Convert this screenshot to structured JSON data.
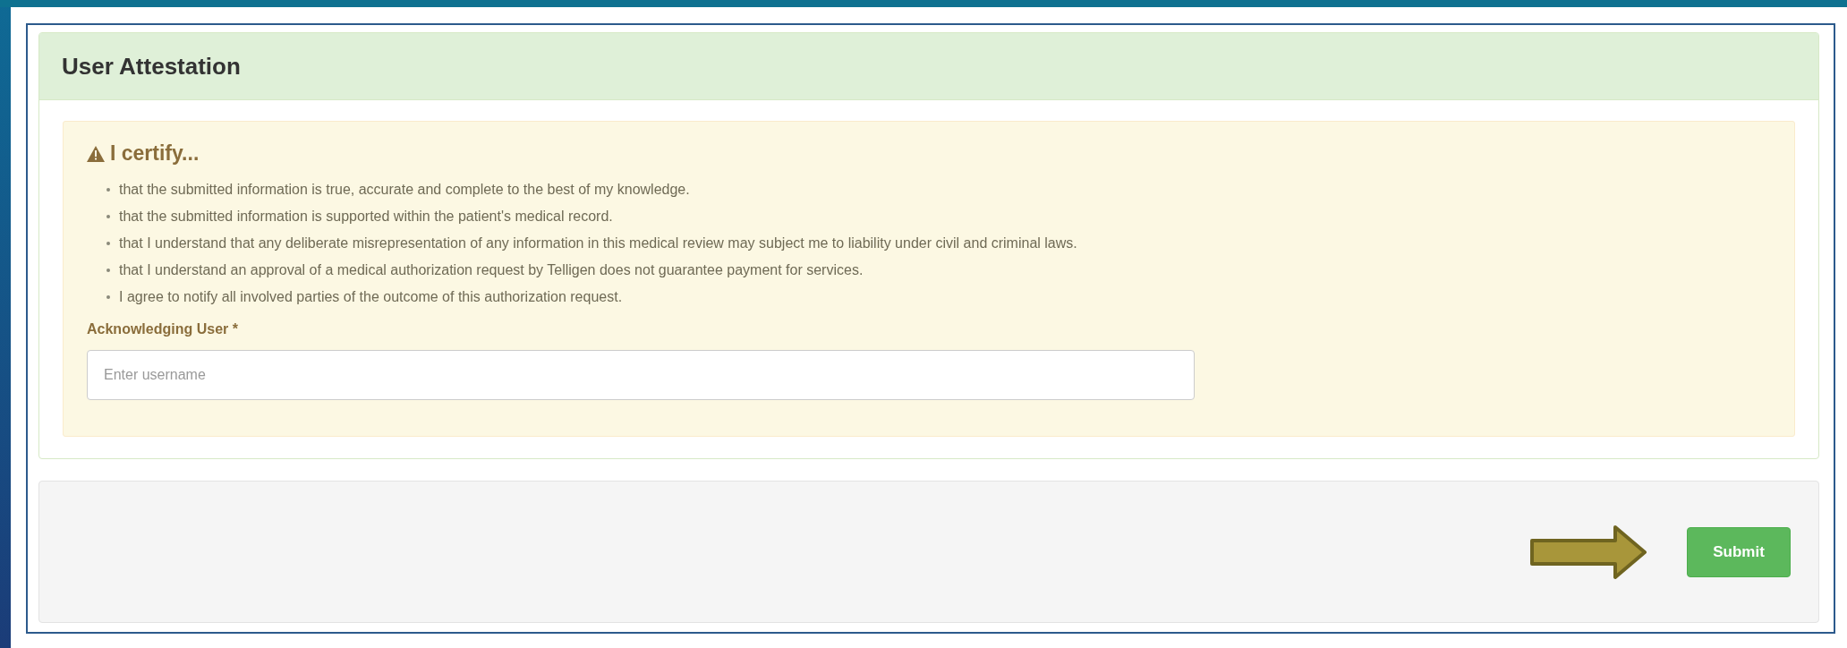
{
  "panel": {
    "title": "User Attestation"
  },
  "certification": {
    "heading": "I certify...",
    "items": [
      "that the submitted information is true, accurate and complete to the best of my knowledge.",
      "that the submitted information is supported within the patient's medical record.",
      "that I understand that any deliberate misrepresentation of any information in this medical review may subject me to liability under civil and criminal laws.",
      "that I understand an approval of a medical authorization request by Telligen does not guarantee payment for services.",
      "I agree to notify all involved parties of the outcome of this authorization request."
    ]
  },
  "field": {
    "label": "Acknowledging User *",
    "placeholder": "Enter username"
  },
  "footer": {
    "button": "Submit"
  }
}
